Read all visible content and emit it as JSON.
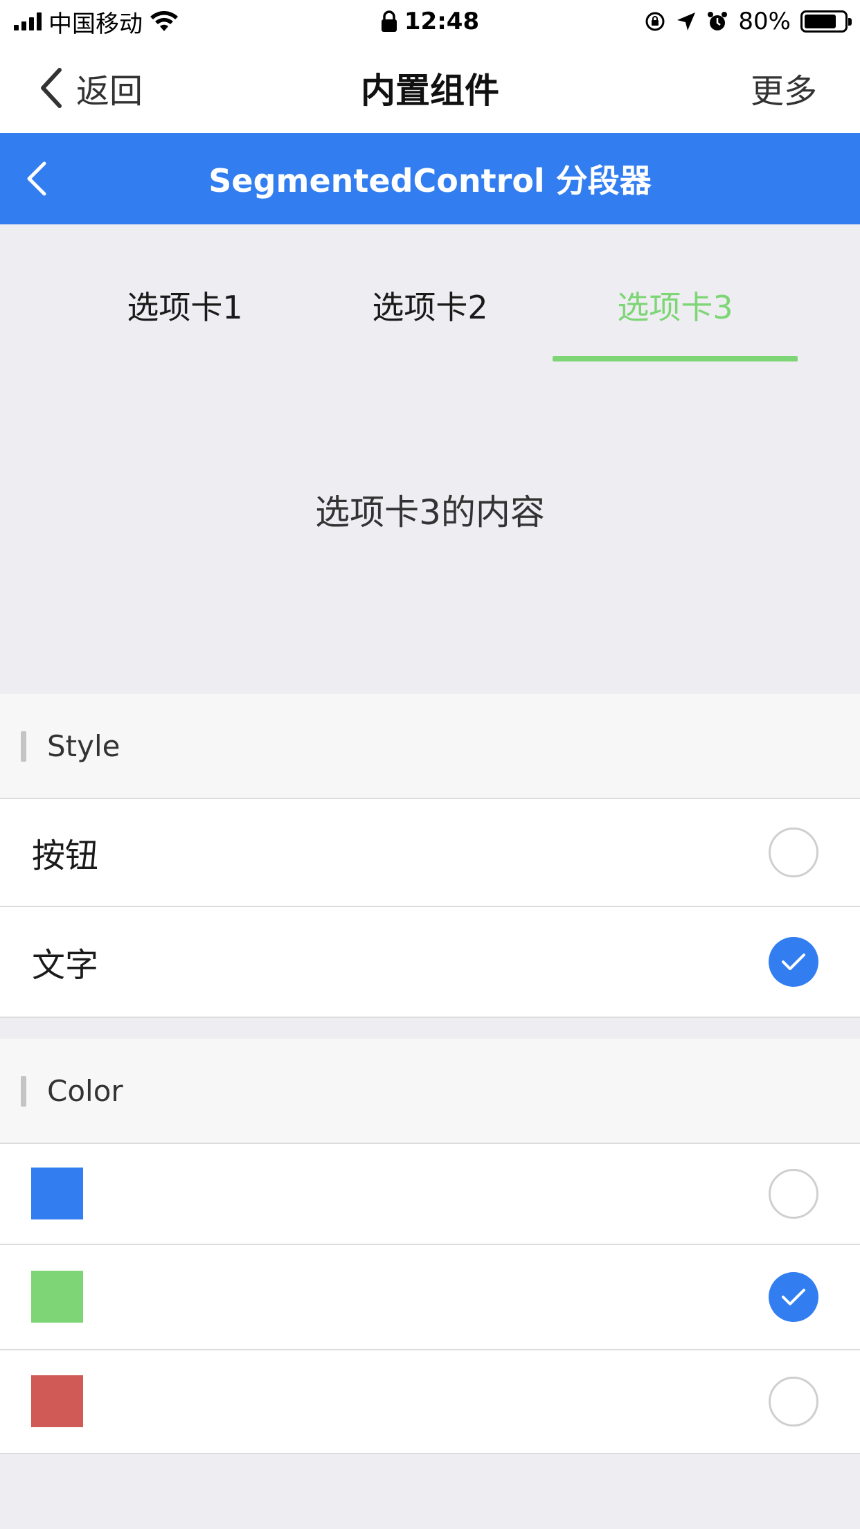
{
  "status_bar": {
    "carrier": "中国移动",
    "time": "12:48",
    "battery_percent": "80%",
    "battery_level": 0.8
  },
  "nav": {
    "back_label": "返回",
    "title": "内置组件",
    "more_label": "更多"
  },
  "header": {
    "title": "SegmentedControl 分段器"
  },
  "segmented": {
    "tabs": [
      "选项卡1",
      "选项卡2",
      "选项卡3"
    ],
    "active_index": 2,
    "active_color": "#7ed576",
    "content": "选项卡3的内容"
  },
  "style_section": {
    "title": "Style",
    "options": [
      {
        "label": "按钮",
        "checked": false
      },
      {
        "label": "文字",
        "checked": true
      }
    ]
  },
  "color_section": {
    "title": "Color",
    "options": [
      {
        "swatch": "#327ef0",
        "checked": false
      },
      {
        "swatch": "#7ed576",
        "checked": true
      },
      {
        "swatch": "#d05a55",
        "checked": false
      }
    ]
  },
  "colors": {
    "primary": "#327ef0",
    "background": "#eeeef2"
  },
  "icons": [
    "signal-icon",
    "wifi-icon",
    "lock-icon",
    "rotation-lock-icon",
    "location-arrow-icon",
    "alarm-icon",
    "battery-icon",
    "back-chevron-icon",
    "check-icon"
  ]
}
